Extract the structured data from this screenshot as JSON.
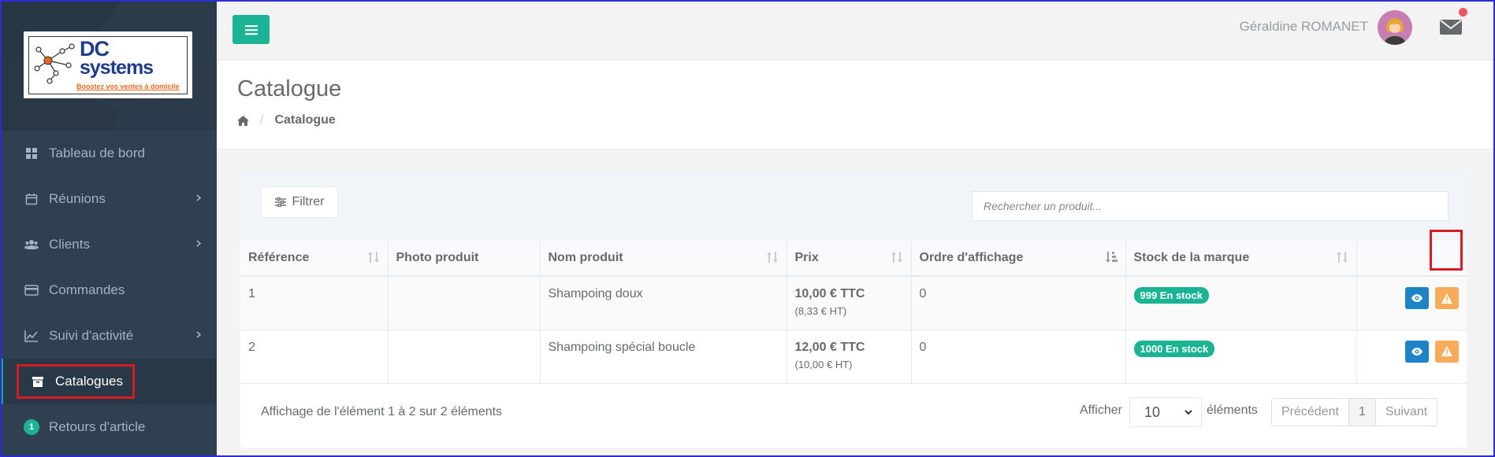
{
  "logo": {
    "line1": "DC",
    "line2": "systems",
    "tagline": "Boostez vos ventes à domicile"
  },
  "sidebar": {
    "items": [
      {
        "label": "Tableau de bord",
        "icon": "dashboard-icon",
        "has_submenu": false
      },
      {
        "label": "Réunions",
        "icon": "calendar-icon",
        "has_submenu": true
      },
      {
        "label": "Clients",
        "icon": "users-icon",
        "has_submenu": true
      },
      {
        "label": "Commandes",
        "icon": "credit-card-icon",
        "has_submenu": false
      },
      {
        "label": "Suivi d'activité",
        "icon": "line-chart-icon",
        "has_submenu": true
      },
      {
        "label": "Catalogues",
        "icon": "archive-icon",
        "has_submenu": false,
        "active": true
      },
      {
        "label": "Retours d'article",
        "icon": "badge",
        "badge": "1",
        "has_submenu": false
      }
    ]
  },
  "topbar": {
    "user_name": "Géraldine ROMANET"
  },
  "page": {
    "title": "Catalogue",
    "breadcrumb_current": "Catalogue"
  },
  "toolbar": {
    "filter_label": "Filtrer",
    "search_placeholder": "Rechercher un produit..."
  },
  "table": {
    "headers": [
      "Référence",
      "Photo produit",
      "Nom produit",
      "Prix",
      "Ordre d'affichage",
      "Stock de la marque",
      ""
    ],
    "rows": [
      {
        "ref": "1",
        "photo": "",
        "name": "Shampoing doux",
        "price": "10,00 € TTC",
        "price_ht": "(8,33 € HT)",
        "order": "0",
        "stock": "999 En stock"
      },
      {
        "ref": "2",
        "photo": "",
        "name": "Shampoing spécial boucle",
        "price": "12,00 € TTC",
        "price_ht": "(10,00 € HT)",
        "order": "0",
        "stock": "1000 En stock"
      }
    ]
  },
  "footer": {
    "info": "Affichage de l'élément 1 à 2 sur 2 éléments",
    "show_label": "Afficher",
    "page_length": "10",
    "elements_label": "éléments",
    "prev": "Précédent",
    "page": "1",
    "next": "Suivant"
  },
  "colors": {
    "sidebar_bg": "#2f4050",
    "accent": "#1ab394",
    "view_button": "#1c84c6",
    "warning_button": "#f8ac59",
    "highlight": "#d71a1f"
  }
}
